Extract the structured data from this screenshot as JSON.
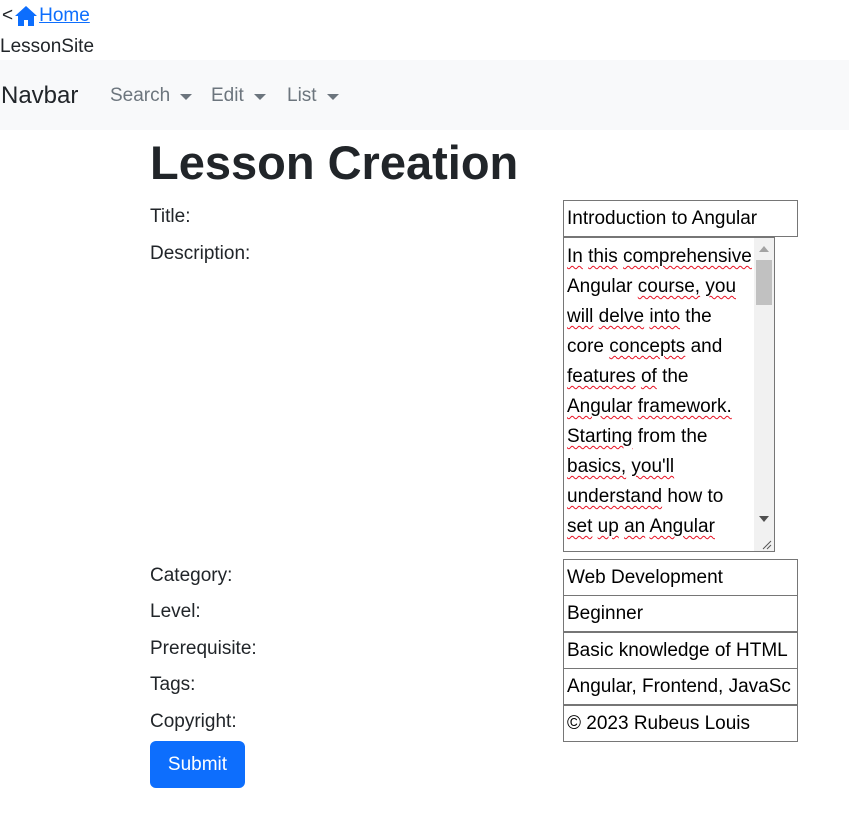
{
  "topbar": {
    "prefix": "<",
    "home_link": "Home",
    "home_icon": "house-icon",
    "site_name": "LessonSite"
  },
  "navbar": {
    "brand": "Navbar",
    "items": [
      {
        "label": "Search"
      },
      {
        "label": "Edit"
      },
      {
        "label": "List"
      }
    ]
  },
  "page": {
    "title": "Lesson Creation"
  },
  "form": {
    "title": {
      "label": "Title:",
      "value": "Introduction to Angular"
    },
    "description": {
      "label": "Description:",
      "value": "In this comprehensive Angular course, you will delve into the core concepts and features of the Angular framework. Starting from the basics, you'll understand how to set up an Angular"
    },
    "category": {
      "label": "Category:",
      "value": "Web Development"
    },
    "level": {
      "label": "Level:",
      "value": "Beginner"
    },
    "prerequisite": {
      "label": "Prerequisite:",
      "value": "Basic knowledge of HTML"
    },
    "tags": {
      "label": "Tags:",
      "value": "Angular, Frontend, JavaSc"
    },
    "copyright": {
      "label": "Copyright:",
      "value": "© 2023 Rubeus Louis"
    },
    "submit_label": "Submit"
  },
  "colors": {
    "link": "#0d6efd",
    "primary_button": "#0d6efd",
    "navbar_bg": "#f8f9fa",
    "nav_text": "#6c757d",
    "spellcheck_underline": "#e81123"
  }
}
